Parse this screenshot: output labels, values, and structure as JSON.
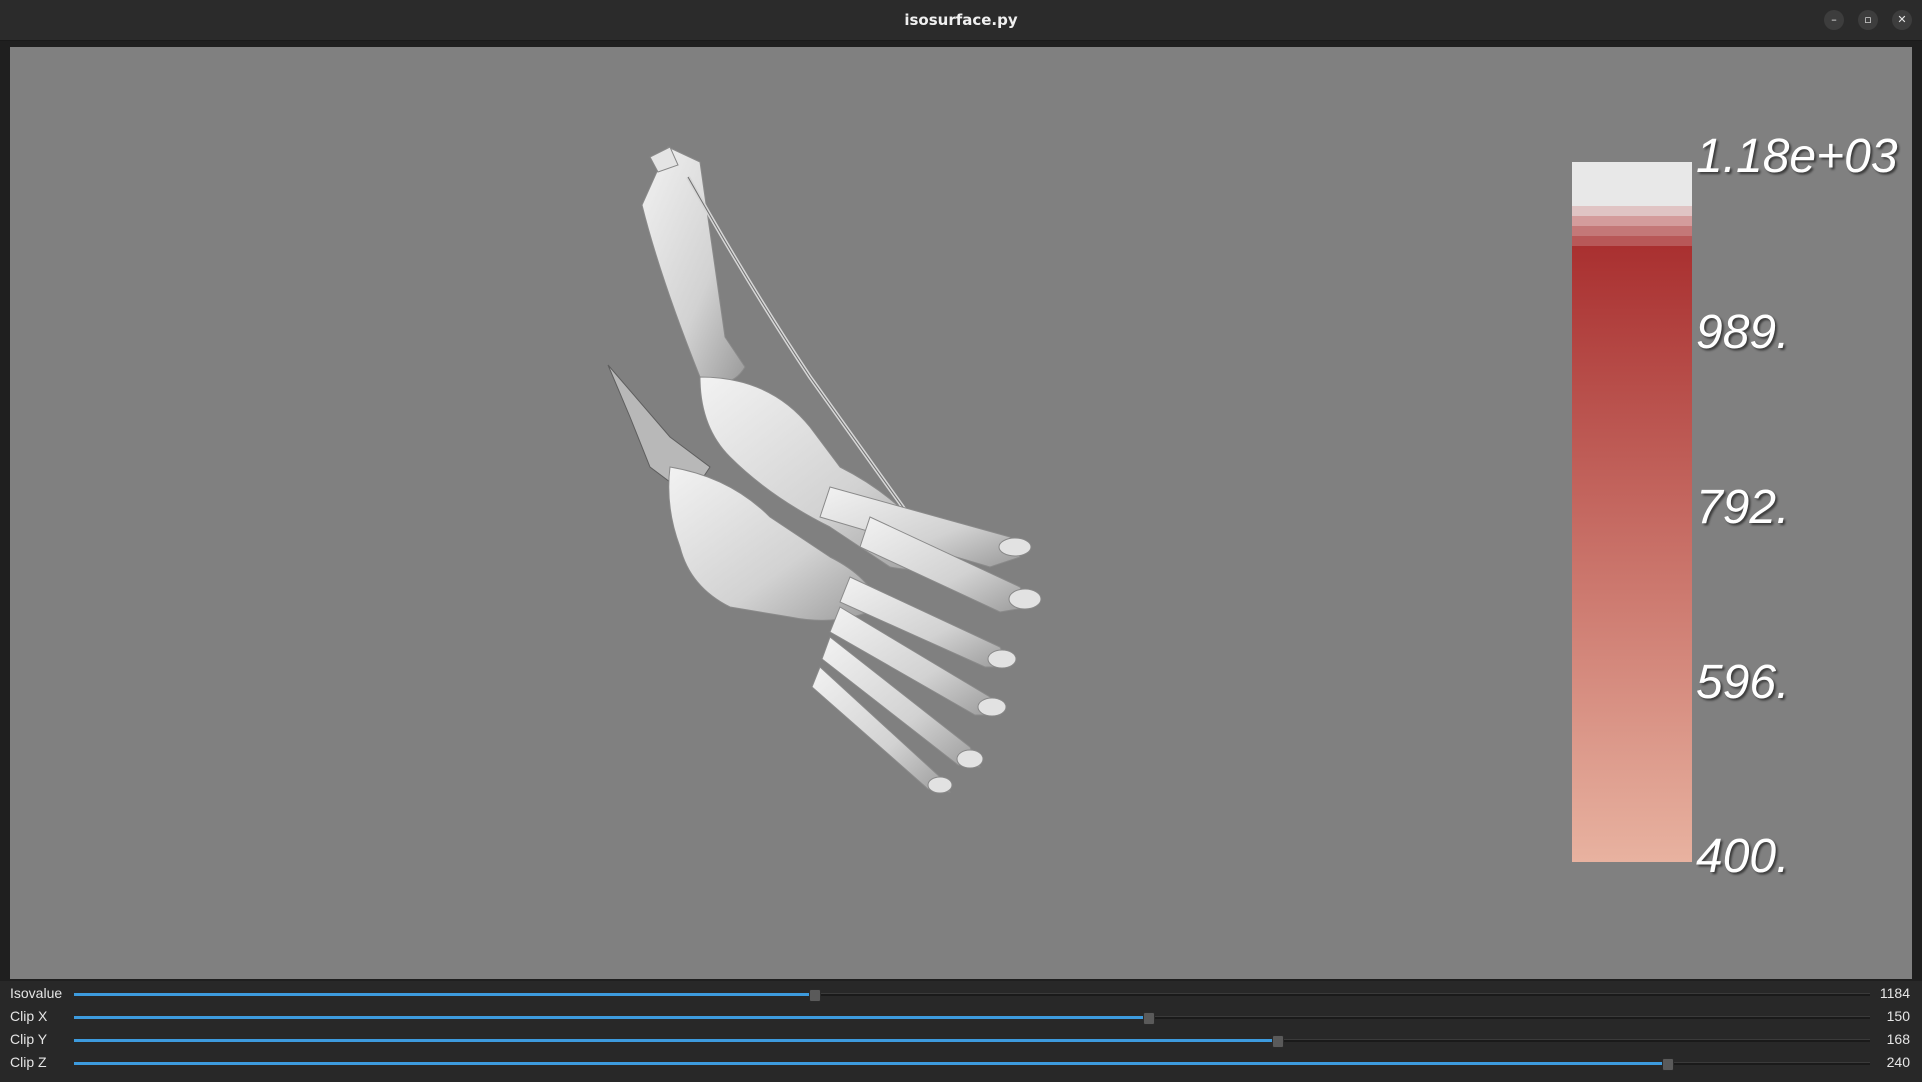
{
  "window": {
    "title": "isosurface.py"
  },
  "titlebar_buttons": {
    "minimize": "–",
    "maximize": "▫",
    "close": "✕"
  },
  "viewport": {
    "background": "#808080",
    "colorbar": {
      "labels": [
        "1.18e+03",
        "989.",
        "792.",
        "596.",
        "400."
      ],
      "top_color": "#e8e8e8",
      "high_color": "#a93030",
      "low_color": "#e8b2a0"
    },
    "surface_color": "#dcdcdc"
  },
  "sliders": [
    {
      "label": "Isovalue",
      "value": "1184",
      "fraction": 0.412
    },
    {
      "label": "Clip X",
      "value": "150",
      "fraction": 0.598
    },
    {
      "label": "Clip Y",
      "value": "168",
      "fraction": 0.67
    },
    {
      "label": "Clip Z",
      "value": "240",
      "fraction": 0.887
    }
  ],
  "accent": "#3d9bde"
}
